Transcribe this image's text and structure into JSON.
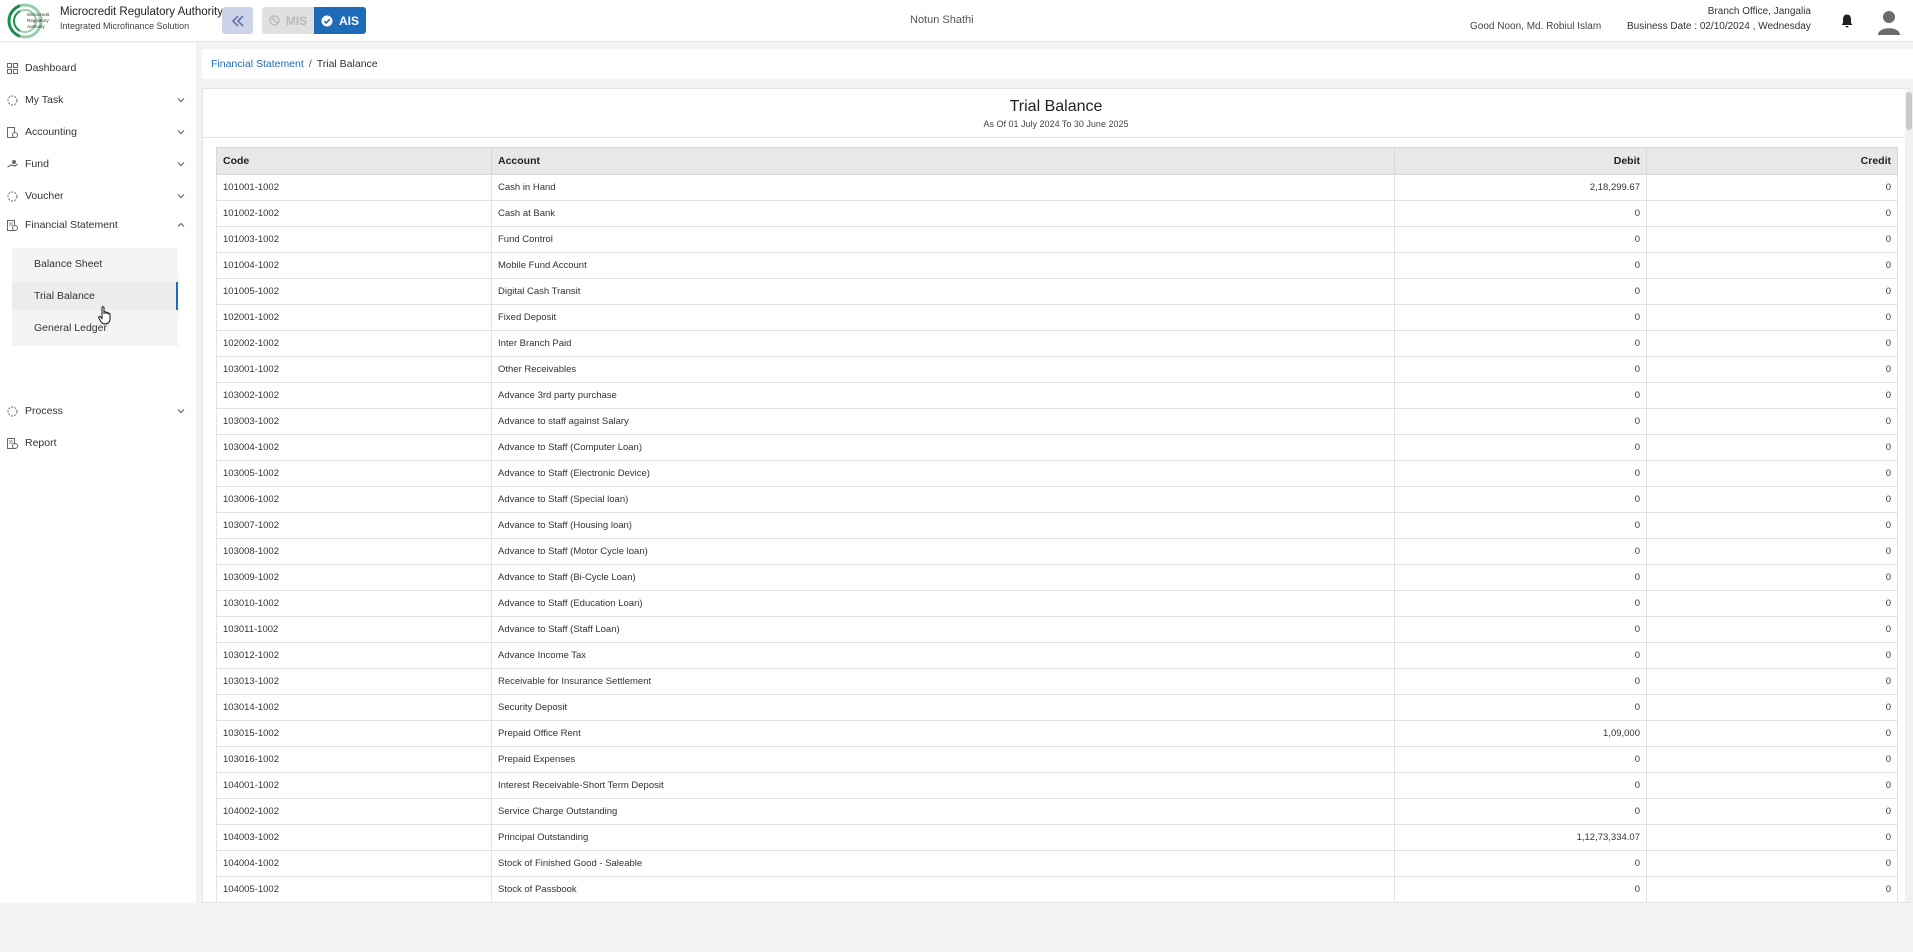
{
  "header": {
    "org_name": "Microcredit Regulatory Authority",
    "org_sub": "Integrated Microfinance Solution",
    "logo_text": "Microcredit Regulatory Authority",
    "mode_mis": "MIS",
    "mode_ais": "AIS",
    "center_title": "Notun Shathi",
    "greeting": "Good Noon, Md. Robiul Islam",
    "branch": "Branch Office, Jangalia",
    "business_date": "Business Date : 02/10/2024 , Wednesday"
  },
  "sidebar": {
    "items": [
      {
        "label": "Dashboard",
        "icon": "grid-icon"
      },
      {
        "label": "My Task",
        "icon": "task-icon"
      },
      {
        "label": "Accounting",
        "icon": "accounting-icon"
      },
      {
        "label": "Fund",
        "icon": "fund-icon"
      },
      {
        "label": "Voucher",
        "icon": "voucher-icon"
      },
      {
        "label": "Financial Statement",
        "icon": "statement-icon"
      },
      {
        "label": "Process",
        "icon": "process-icon"
      },
      {
        "label": "Report",
        "icon": "report-icon"
      }
    ],
    "sub_items": [
      {
        "label": "Balance Sheet"
      },
      {
        "label": "Trial Balance"
      },
      {
        "label": "General Ledger"
      }
    ]
  },
  "breadcrumb": {
    "parent": "Financial Statement",
    "separator": "/",
    "current": "Trial Balance"
  },
  "report": {
    "title": "Trial Balance",
    "subtitle": "As Of 01 July 2024 To 30 June 2025",
    "columns": {
      "code": "Code",
      "account": "Account",
      "debit": "Debit",
      "credit": "Credit"
    },
    "rows": [
      {
        "code": "101001-1002",
        "account": "Cash in Hand",
        "debit": "2,18,299.67",
        "credit": "0"
      },
      {
        "code": "101002-1002",
        "account": "Cash at Bank",
        "debit": "0",
        "credit": "0"
      },
      {
        "code": "101003-1002",
        "account": "Fund Control",
        "debit": "0",
        "credit": "0"
      },
      {
        "code": "101004-1002",
        "account": "Mobile Fund Account",
        "debit": "0",
        "credit": "0"
      },
      {
        "code": "101005-1002",
        "account": "Digital Cash Transit",
        "debit": "0",
        "credit": "0"
      },
      {
        "code": "102001-1002",
        "account": "Fixed Deposit",
        "debit": "0",
        "credit": "0"
      },
      {
        "code": "102002-1002",
        "account": "Inter Branch Paid",
        "debit": "0",
        "credit": "0"
      },
      {
        "code": "103001-1002",
        "account": "Other Receivables",
        "debit": "0",
        "credit": "0"
      },
      {
        "code": "103002-1002",
        "account": "Advance 3rd party purchase",
        "debit": "0",
        "credit": "0"
      },
      {
        "code": "103003-1002",
        "account": "Advance to staff against Salary",
        "debit": "0",
        "credit": "0"
      },
      {
        "code": "103004-1002",
        "account": "Advance to Staff (Computer Loan)",
        "debit": "0",
        "credit": "0"
      },
      {
        "code": "103005-1002",
        "account": "Advance to Staff (Electronic Device)",
        "debit": "0",
        "credit": "0"
      },
      {
        "code": "103006-1002",
        "account": "Advance to Staff (Special loan)",
        "debit": "0",
        "credit": "0"
      },
      {
        "code": "103007-1002",
        "account": "Advance to Staff (Housing loan)",
        "debit": "0",
        "credit": "0"
      },
      {
        "code": "103008-1002",
        "account": "Advance to Staff (Motor Cycle loan)",
        "debit": "0",
        "credit": "0"
      },
      {
        "code": "103009-1002",
        "account": "Advance to Staff (Bi-Cycle Loan)",
        "debit": "0",
        "credit": "0"
      },
      {
        "code": "103010-1002",
        "account": "Advance to Staff (Education Loan)",
        "debit": "0",
        "credit": "0"
      },
      {
        "code": "103011-1002",
        "account": "Advance to Staff (Staff Loan)",
        "debit": "0",
        "credit": "0"
      },
      {
        "code": "103012-1002",
        "account": "Advance Income Tax",
        "debit": "0",
        "credit": "0"
      },
      {
        "code": "103013-1002",
        "account": "Receivable for Insurance Settlement",
        "debit": "0",
        "credit": "0"
      },
      {
        "code": "103014-1002",
        "account": "Security Deposit",
        "debit": "0",
        "credit": "0"
      },
      {
        "code": "103015-1002",
        "account": "Prepaid Office Rent",
        "debit": "1,09,000",
        "credit": "0"
      },
      {
        "code": "103016-1002",
        "account": "Prepaid Expenses",
        "debit": "0",
        "credit": "0"
      },
      {
        "code": "104001-1002",
        "account": "Interest Receivable-Short Term Deposit",
        "debit": "0",
        "credit": "0"
      },
      {
        "code": "104002-1002",
        "account": "Service Charge Outstanding",
        "debit": "0",
        "credit": "0"
      },
      {
        "code": "104003-1002",
        "account": "Principal Outstanding",
        "debit": "1,12,73,334.07",
        "credit": "0"
      },
      {
        "code": "104004-1002",
        "account": "Stock of Finished Good - Saleable",
        "debit": "0",
        "credit": "0"
      },
      {
        "code": "104005-1002",
        "account": "Stock of Passbook",
        "debit": "0",
        "credit": "0"
      }
    ]
  },
  "colors": {
    "accent": "#1e6bb8",
    "link": "#1e6bb8",
    "header_bg": "#ffffff",
    "page_bg": "#f3f3f3"
  }
}
